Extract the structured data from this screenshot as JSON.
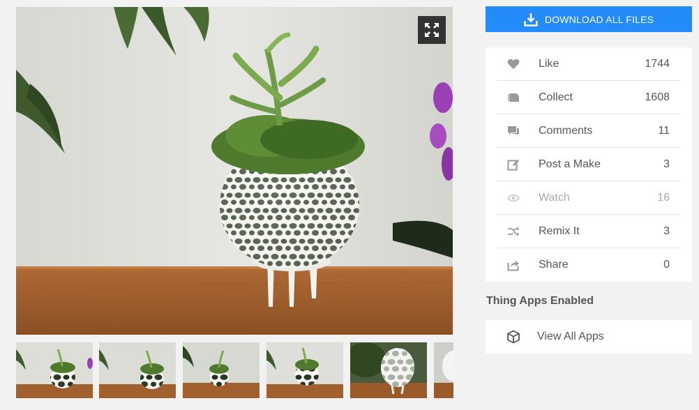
{
  "actions": {
    "download_label": "DOWNLOAD ALL FILES"
  },
  "stats": [
    {
      "label": "Like",
      "count": "1744",
      "icon": "heart-icon"
    },
    {
      "label": "Collect",
      "count": "1608",
      "icon": "collection-icon"
    },
    {
      "label": "Comments",
      "count": "11",
      "icon": "comment-icon"
    },
    {
      "label": "Post a Make",
      "count": "3",
      "icon": "edit-icon"
    },
    {
      "label": "Watch",
      "count": "16",
      "icon": "eye-icon"
    },
    {
      "label": "Remix It",
      "count": "3",
      "icon": "shuffle-icon"
    },
    {
      "label": "Share",
      "count": "0",
      "icon": "share-icon"
    }
  ],
  "apps": {
    "heading": "Thing Apps Enabled",
    "view_all_label": "View All Apps"
  },
  "gallery": {
    "thumbnail_count": 6
  },
  "colors": {
    "accent": "#248bfb",
    "icon_gray": "#999999"
  }
}
